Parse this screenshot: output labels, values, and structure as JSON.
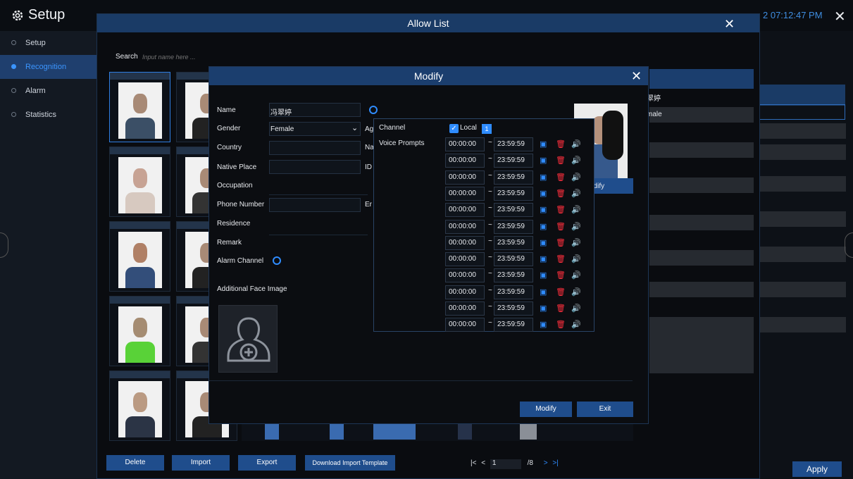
{
  "app": {
    "title": "Setup",
    "time": "2 07:12:47 PM"
  },
  "sidebar": {
    "items": [
      {
        "label": "Setup",
        "active": false
      },
      {
        "label": "Recognition",
        "active": true
      },
      {
        "label": "Alarm",
        "active": false
      },
      {
        "label": "Statistics",
        "active": false
      }
    ]
  },
  "right_panel": {
    "name_fragment": "翠婷",
    "gender_fragment": "male",
    "modify_fragment": "odify",
    "apply": "Apply"
  },
  "allow_list": {
    "title": "Allow List",
    "search_label": "Search",
    "search_placeholder": "Input name here ...",
    "buttons": {
      "delete": "Delete",
      "import": "Import",
      "export": "Export",
      "download": "Download Import Template"
    },
    "pagination": {
      "first": "|<",
      "prev": "<",
      "page": "1",
      "total": "/8",
      "next": ">",
      "last": ">|"
    }
  },
  "modify": {
    "title": "Modify",
    "fields": {
      "name": {
        "label": "Name",
        "value": "冯翠婷"
      },
      "gender": {
        "label": "Gender",
        "value": "Female"
      },
      "country": {
        "label": "Country",
        "value": ""
      },
      "native_place": {
        "label": "Native Place",
        "value": ""
      },
      "occupation": {
        "label": "Occupation",
        "value": ""
      },
      "phone": {
        "label": "Phone Number",
        "value": ""
      },
      "residence": {
        "label": "Residence",
        "value": ""
      },
      "remark": {
        "label": "Remark",
        "value": ""
      }
    },
    "frag_age": "Ag",
    "frag_na": "Na",
    "frag_id": "ID",
    "frag_en": "Er",
    "alarm_channel": "Alarm Channel",
    "additional_face": "Additional Face Image",
    "modify_label": "Modify",
    "exit_label": "Exit"
  },
  "voice": {
    "channel_label": "Channel",
    "local_label": "Local",
    "channel_number": "1",
    "voice_prompts_label": "Voice Prompts",
    "rows": [
      {
        "start": "00:00:00",
        "end": "23:59:59"
      },
      {
        "start": "00:00:00",
        "end": "23:59:59"
      },
      {
        "start": "00:00:00",
        "end": "23:59:59"
      },
      {
        "start": "00:00:00",
        "end": "23:59:59"
      },
      {
        "start": "00:00:00",
        "end": "23:59:59"
      },
      {
        "start": "00:00:00",
        "end": "23:59:59"
      },
      {
        "start": "00:00:00",
        "end": "23:59:59"
      },
      {
        "start": "00:00:00",
        "end": "23:59:59"
      },
      {
        "start": "00:00:00",
        "end": "23:59:59"
      },
      {
        "start": "00:00:00",
        "end": "23:59:59"
      },
      {
        "start": "00:00:00",
        "end": "23:59:59"
      },
      {
        "start": "00:00:00",
        "end": "23:59:59"
      }
    ]
  },
  "colors": {
    "accent": "#2f8cff",
    "delete": "#ff2f3d",
    "header": "#1b3e6e"
  }
}
